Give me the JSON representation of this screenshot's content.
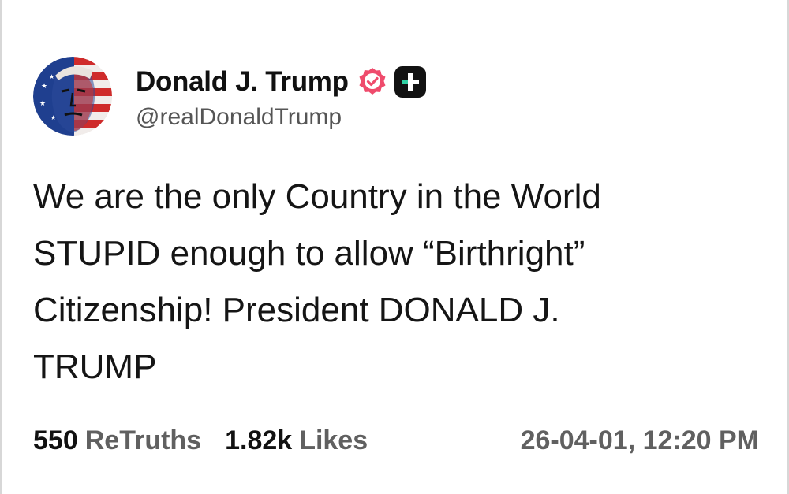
{
  "author": {
    "display_name": "Donald J. Trump",
    "handle": "@realDonaldTrump",
    "verified_icon": "verified-badge-icon",
    "plus_icon": "plus-badge-icon",
    "verified_color": "#EF4B6C"
  },
  "post": {
    "text": "We are the only Country in the World\nSTUPID enough to allow “Birthright”\nCitizenship! President DONALD J.\nTRUMP"
  },
  "stats": {
    "retruths_count": "550",
    "retruths_label": "ReTruths",
    "likes_count": "1.82k",
    "likes_label": "Likes",
    "timestamp": "26-04-01, 12:20 PM"
  }
}
